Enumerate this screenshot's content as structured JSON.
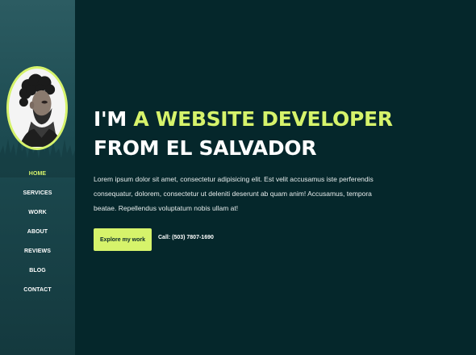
{
  "nav": {
    "items": [
      "HOME",
      "SERVICES",
      "WORK",
      "ABOUT",
      "REVIEWS",
      "BLOG",
      "CONTACT"
    ],
    "active": "HOME"
  },
  "hero": {
    "headline_prefix": "I'M ",
    "headline_accent": "A WEBSITE DEVELOPER",
    "headline_suffix": " FROM EL SALVADOR",
    "bio": "Lorem ipsum dolor sit amet, consectetur adipisicing elit. Est velit accusamus iste perferendis consequatur, dolorem, consectetur ut deleniti deserunt ab quam anim! Accusamus, tempora beatae. Repellendus voluptatum nobis ullam at!",
    "cta_label": "Explore my work",
    "phone": "Call: (503) 7807-1690"
  },
  "colors": {
    "accent": "#d6f36b",
    "background": "#05272b",
    "sidebar": "#1c4a50"
  },
  "icons": {
    "avatar": "profile-photo-man-curly-hair"
  }
}
